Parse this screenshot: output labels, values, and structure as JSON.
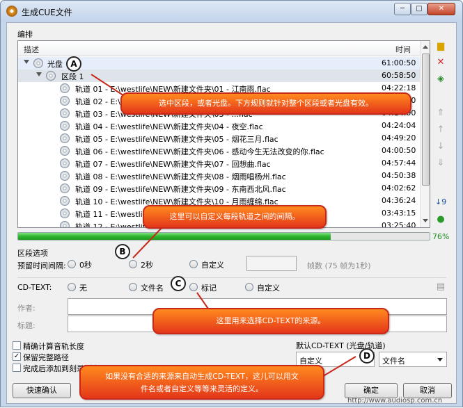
{
  "window": {
    "title": "生成CUE文件",
    "minimize": "─",
    "maximize": "□",
    "close": "✕"
  },
  "arrange": {
    "group_label": "编排",
    "col_desc": "描述",
    "col_time": "时间",
    "disc": {
      "label": "光盘",
      "time": "61:00:50"
    },
    "segment": {
      "label": "区段 1",
      "time": "60:58:50"
    },
    "tracks": [
      {
        "label": "轨道 01 - E:\\westlife\\NEW\\新建文件夹\\01 - 江南雨.flac",
        "time": "04:22:18"
      },
      {
        "label": "轨道 02 - E:\\westlife\\NEW\\新建文件夹\\02 - ...flac",
        "time": "04:10:00"
      },
      {
        "label": "轨道 03 - E:\\westlife\\NEW\\新建文件夹\\03 - ...flac",
        "time": "04:14:00"
      },
      {
        "label": "轨道 04 - E:\\westlife\\NEW\\新建文件夹\\04 - 夜空.flac",
        "time": "04:24:04"
      },
      {
        "label": "轨道 05 - E:\\westlife\\NEW\\新建文件夹\\05 - 烟花三月.flac",
        "time": "04:49:20"
      },
      {
        "label": "轨道 06 - E:\\westlife\\NEW\\新建文件夹\\06 - 感动今生无法改变的你.flac",
        "time": "04:00:50"
      },
      {
        "label": "轨道 07 - E:\\westlife\\NEW\\新建文件夹\\07 - 回想曲.flac",
        "time": "04:57:44"
      },
      {
        "label": "轨道 08 - E:\\westlife\\NEW\\新建文件夹\\08 - 烟雨唱杨州.flac",
        "time": "04:50:38"
      },
      {
        "label": "轨道 09 - E:\\westlife\\NEW\\新建文件夹\\09 - 东南西北风.flac",
        "time": "04:02:62"
      },
      {
        "label": "轨道 10 - E:\\westlife\\NEW\\新建文件夹\\10 - 月雨缠绵.flac",
        "time": "04:36:24"
      },
      {
        "label": "轨道 11 - E:\\westlife\\NEW\\新建文件夹\\11 - ...flac",
        "time": "03:43:15"
      },
      {
        "label": "轨道 12 - E:\\westlife\\NEW\\新建文件夹\\12 - ...flac",
        "time": "03:25:40"
      }
    ]
  },
  "progress": {
    "value": 0.76,
    "label": "76%"
  },
  "segment_options": {
    "group_label": "区段选项",
    "gap_label": "预留时间间隔:",
    "options": [
      "0秒",
      "2秒",
      "自定义"
    ],
    "frames_hint": "帧数 (75 帧为1秒)"
  },
  "cdtext": {
    "label": "CD-TEXT:",
    "options": [
      "无",
      "文件名",
      "标记",
      "自定义"
    ],
    "author_label": "作者:",
    "title_label": "标题:"
  },
  "checkboxes": [
    {
      "label": "精确计算音轨长度",
      "checked": false
    },
    {
      "label": "保留完整路径",
      "checked": true
    },
    {
      "label": "完成后添加到刻录列表",
      "checked": false
    }
  ],
  "default_cdtext": {
    "label": "默认CD-TEXT (光盘/轨道)",
    "combo1": "自定义",
    "combo2": "文件名"
  },
  "buttons": {
    "quick": "快速确认",
    "ok": "确定",
    "cancel": "取消"
  },
  "callouts": {
    "a": "选中区段，或者光盘。下方规则就针对整个区段或者光盘有效。",
    "b": "这里可以自定义每段轨道之间的间隔。",
    "c": "这里用来选择CD-TEXT的来源。",
    "d1": "如果没有合适的来源来自动生成CD-TEXT，这儿可以用文",
    "d2": "件名或者自定义等等来灵活的定义。"
  },
  "badges": {
    "a": "A",
    "b": "B",
    "c": "C",
    "d": "D"
  },
  "watermark": "http://www.audiosp.com.cn",
  "icons": {
    "open": "folder-icon",
    "remove": "delete-icon",
    "cd": "cd-icon",
    "sort": "sort-icon",
    "refresh": "refresh-icon"
  }
}
